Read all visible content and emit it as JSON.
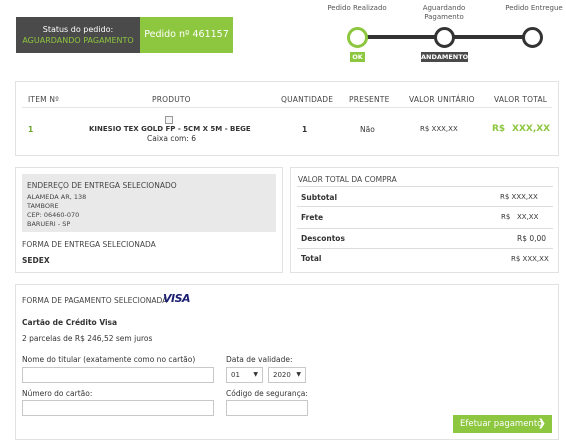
{
  "status": {
    "label": "Status do pedido:",
    "value": "AGUARDANDO PAGAMENTO",
    "order_number": "Pedido nº 461157"
  },
  "tracker": {
    "steps": [
      {
        "label": "Pedido Realizado",
        "badge": "OK"
      },
      {
        "label": "Aguardando Pagamento",
        "badge": "ANDAMENTO"
      },
      {
        "label": "Pedido Entregue",
        "badge": ""
      }
    ]
  },
  "items_table": {
    "headers": [
      "ITEM Nº",
      "PRODUTO",
      "QUANTIDADE",
      "PRESENTE",
      "VALOR UNITÁRIO",
      "VALOR TOTAL"
    ],
    "rows": [
      {
        "item": "1",
        "product": "KINESIO TEX GOLD FP - 5CM X 5M - BEGE",
        "product_sub": "Caixa com: 6",
        "quantity": "1",
        "gift": "Não",
        "unit_price": "R$ XXX,XX",
        "total_currency": "R$",
        "total_value": "XXX,XX"
      }
    ]
  },
  "delivery": {
    "address_title": "ENDEREÇO DE ENTREGA SELECIONADO",
    "address_lines": [
      "ALAMEDA AR, 138",
      "TAMBORE",
      "CEP: 06460-070",
      "BARUERI - SP"
    ],
    "method_title": "FORMA DE ENTREGA SELECIONADA",
    "method": "SEDEX"
  },
  "summary": {
    "title": "VALOR TOTAL DA COMPRA",
    "rows": [
      {
        "label": "Subtotal",
        "value": "R$ XXX,XX"
      },
      {
        "label": "Frete",
        "value": "R$   XX,XX"
      },
      {
        "label": "Descontos",
        "value": "R$ 0,00"
      },
      {
        "label": "Total",
        "value": "R$ XXX,XX"
      }
    ]
  },
  "payment": {
    "title": "FORMA DE PAGAMENTO SELECIONADA",
    "brand": "VISA",
    "method": "Cartão de Crédito Visa",
    "installments": "2 parcelas de R$ 246,52 sem juros",
    "holder_label": "Nome do titular (exatamente como no cartão)",
    "holder_value": "",
    "number_label": "Número do cartão:",
    "number_value": "",
    "validity_label": "Data de validade:",
    "month": "01",
    "year": "2020",
    "cvv_label": "Código de segurança:",
    "cvv_value": "",
    "submit": "Efetuar pagamento"
  },
  "colors": {
    "accent": "#8dc63f",
    "dark": "#4a4a4a",
    "visa": "#1a1f71"
  }
}
